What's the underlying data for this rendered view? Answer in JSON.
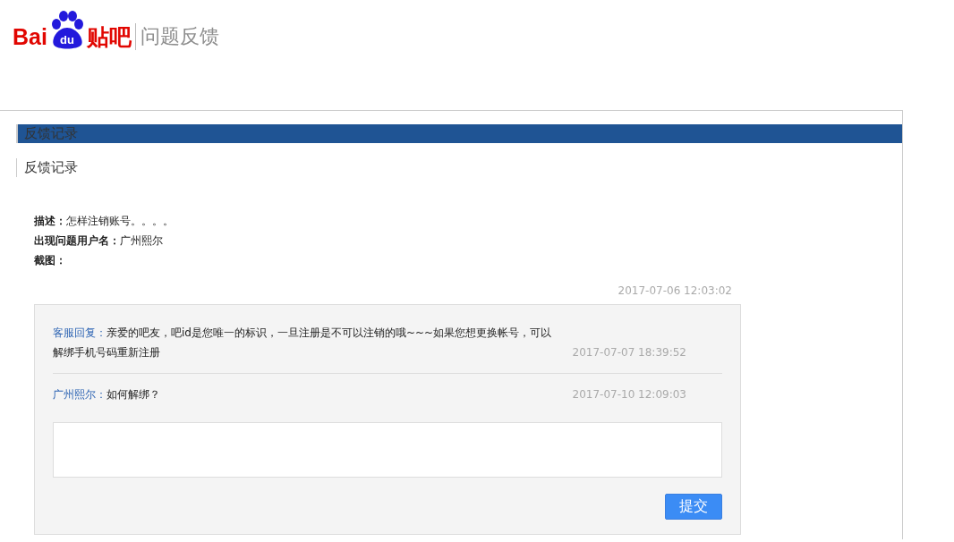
{
  "logo": {
    "left": "Bai",
    "paw": "du",
    "right": "贴吧",
    "subtitle": "问题反馈"
  },
  "banner": {
    "title": "反馈记录"
  },
  "section": {
    "title": "反馈记录"
  },
  "details": [
    {
      "label": "描述：",
      "value": "怎样注销账号。。。。"
    },
    {
      "label": "出现问题用户名：",
      "value": "广州熙尔"
    },
    {
      "label": "截图："
    }
  ],
  "submitted_time": "2017-07-06 12:03:02",
  "replies": [
    {
      "author": "客服回复：",
      "text": "亲爱的吧友，吧id是您唯一的标识，一旦注册是不可以注销的哦~~~如果您想更换帐号，可以解绑手机号码重新注册",
      "time": "2017-07-07 18:39:52"
    },
    {
      "author": "广州熙尔：",
      "text": "如何解绑？",
      "time": "2017-07-10 12:09:03"
    }
  ],
  "submit_button": "提交"
}
